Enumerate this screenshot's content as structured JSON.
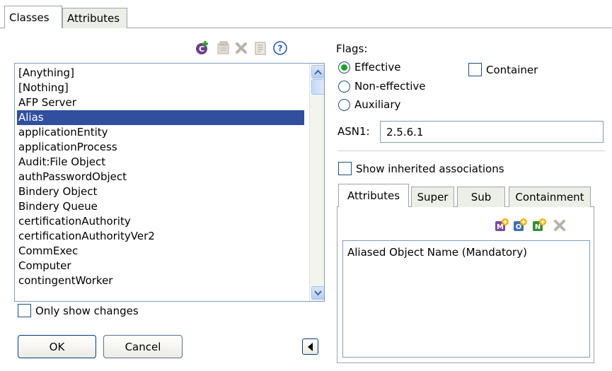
{
  "tabs": {
    "classes": "Classes",
    "attributes": "Attributes"
  },
  "toolbar_icons": [
    "add-class-icon",
    "properties-icon",
    "delete-icon",
    "notes-icon",
    "help-icon"
  ],
  "classes": [
    "[Anything]",
    "[Nothing]",
    "AFP Server",
    "Alias",
    "applicationEntity",
    "applicationProcess",
    "Audit:File Object",
    "authPasswordObject",
    "Bindery Object",
    "Bindery Queue",
    "certificationAuthority",
    "certificationAuthorityVer2",
    "CommExec",
    "Computer",
    "contingentWorker"
  ],
  "selected_class": "Alias",
  "only_show_changes": {
    "label": "Only show changes",
    "checked": false
  },
  "buttons": {
    "ok": "OK",
    "cancel": "Cancel"
  },
  "flags": {
    "label": "Flags:",
    "effective": "Effective",
    "non_effective": "Non-effective",
    "auxiliary": "Auxiliary",
    "selected": "Effective",
    "container": "Container"
  },
  "asn1": {
    "label": "ASN1:",
    "value": "2.5.6.1"
  },
  "show_inherited": "Show inherited associations",
  "subtabs": {
    "attributes": "Attributes",
    "super": "Super",
    "sub": "Sub",
    "containment": "Containment"
  },
  "associations": [
    "Aliased Object Name (Mandatory)"
  ],
  "colors": {
    "selection": "#30509f",
    "border": "#7f9db9",
    "radio_dot": "#21a121"
  }
}
